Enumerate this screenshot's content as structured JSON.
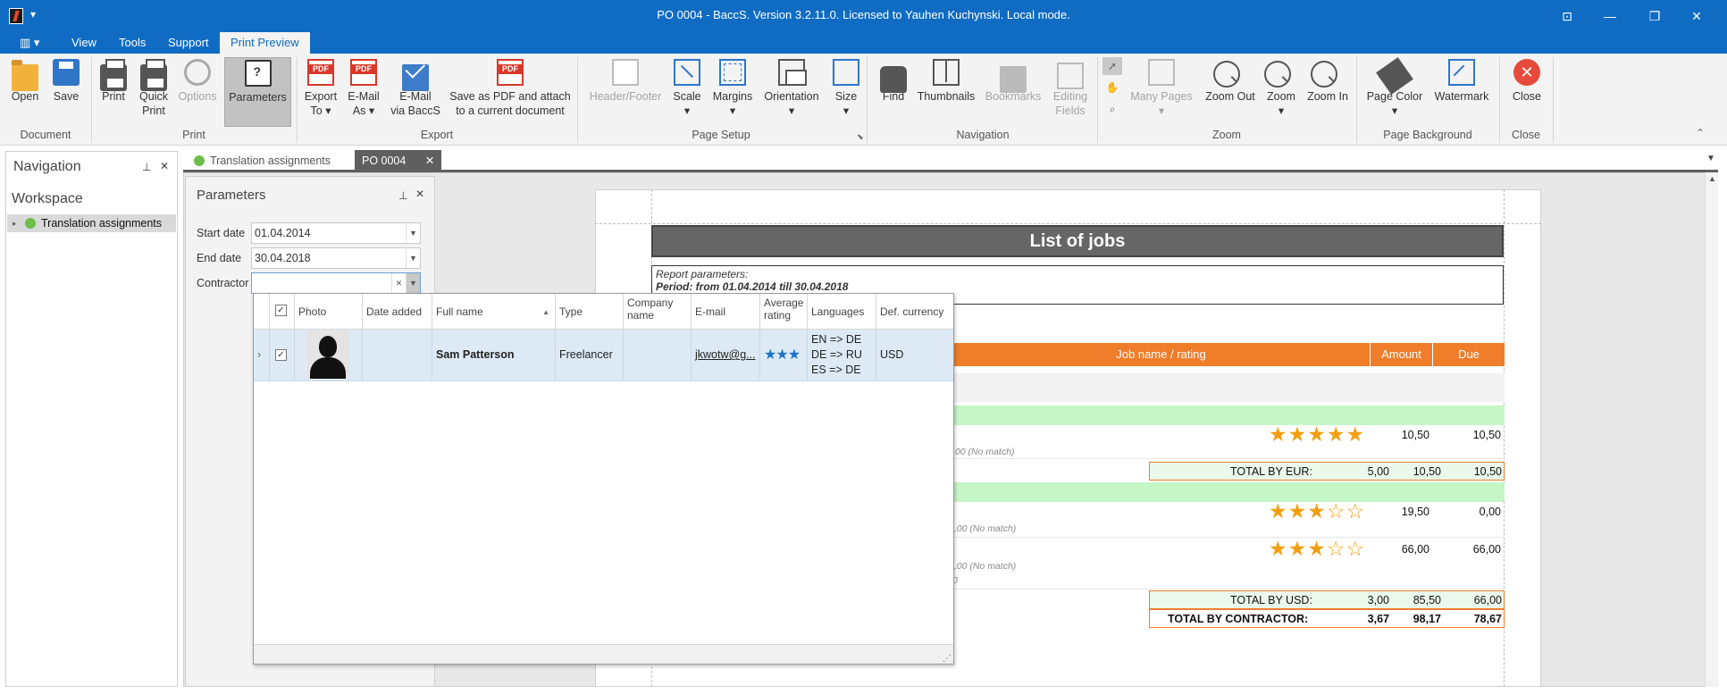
{
  "window": {
    "title": "PO 0004 - BaccS. Version 3.2.11.0. Licensed to Yauhen Kuchynski. Local mode.",
    "quick_access_glyph": "▾",
    "controls": [
      "⊡",
      "—",
      "❐",
      "✕"
    ]
  },
  "menu": {
    "app_menu": "▥ ▾",
    "items": [
      "View",
      "Tools",
      "Support",
      "Print Preview"
    ]
  },
  "ribbon": {
    "document": {
      "open": "Open",
      "save": "Save",
      "group": "Document"
    },
    "print": {
      "print": "Print",
      "quick_print_1": "Quick",
      "quick_print_2": "Print",
      "options": "Options",
      "parameters": "Parameters",
      "group": "Print"
    },
    "export": {
      "export_to_1": "Export",
      "export_to_2": "To ▾",
      "email_as_1": "E-Mail",
      "email_as_2": "As ▾",
      "email_baccs_1": "E-Mail",
      "email_baccs_2": "via BaccS",
      "save_pdf_1": "Save as PDF and attach",
      "save_pdf_2": "to a current document",
      "group": "Export"
    },
    "page_setup": {
      "header_footer": "Header/Footer",
      "scale": "Scale",
      "margins": "Margins",
      "orientation": "Orientation",
      "size": "Size",
      "dropdown": "▾",
      "group": "Page Setup"
    },
    "navigation": {
      "find": "Find",
      "thumbnails": "Thumbnails",
      "bookmarks": "Bookmarks",
      "editing_fields_1": "Editing",
      "editing_fields_2": "Fields",
      "group": "Navigation"
    },
    "zoom": {
      "many_pages": "Many Pages",
      "zoom_out": "Zoom Out",
      "zoom": "Zoom",
      "zoom_in": "Zoom In",
      "group": "Zoom"
    },
    "page_background": {
      "page_color": "Page Color",
      "watermark": "Watermark",
      "group": "Page Background"
    },
    "close": {
      "close": "Close",
      "group": "Close"
    }
  },
  "nav_pane": {
    "title": "Navigation",
    "workspace": "Workspace",
    "items": [
      "Translation assignments"
    ]
  },
  "doc_tabs": [
    "Translation assignments",
    "PO 0004"
  ],
  "parameters": {
    "title": "Parameters",
    "start_date_label": "Start date",
    "start_date": "01.04.2014",
    "end_date_label": "End date",
    "end_date": "30.04.2018",
    "contractor_label": "Contractor",
    "contractor": ""
  },
  "contractor_grid": {
    "columns": [
      "Photo",
      "Date added",
      "Full name",
      "Type",
      "Company name",
      "E-mail",
      "Average rating",
      "Languages",
      "Def. currency"
    ],
    "sort_indicator": "▲",
    "row": {
      "expander": "›",
      "checked": "✓",
      "date_added": "",
      "full_name": "Sam Patterson",
      "type": "Freelancer",
      "company": "",
      "email": "jkwotw@g...",
      "rating_stars": "★★★",
      "rating": 3,
      "languages": [
        "EN => DE",
        "DE => RU",
        "ES => DE"
      ],
      "currency": "USD"
    }
  },
  "report": {
    "title": "List of jobs",
    "params_label": "Report parameters:",
    "period": "Period: from 01.04.2014 till 30.04.2018",
    "columns": {
      "job": "Job name / rating",
      "amount": "Amount",
      "due": "Due"
    },
    "rows": [
      {
        "stars": "★★★★★",
        "rating": 5,
        "amount": "10,50",
        "due": "10,50",
        "note": ",00  (No match)"
      },
      {
        "stars": "★★★☆☆",
        "rating": 3,
        "amount": "19,50",
        "due": "0,00",
        "note": "0,00  (No match)"
      },
      {
        "stars": "★★★☆☆",
        "rating": 3,
        "amount": "66,00",
        "due": "66,00",
        "note": "0,00  (No match)",
        "note2": "0"
      }
    ],
    "total_eur": {
      "label": "TOTAL BY EUR:",
      "rating": "5,00",
      "amount": "10,50",
      "due": "10,50"
    },
    "total_usd": {
      "label": "TOTAL BY USD:",
      "rating": "3,00",
      "amount": "85,50",
      "due": "66,00"
    },
    "total_contractor": {
      "label": "TOTAL BY CONTRACTOR:",
      "rating": "3,67",
      "amount": "98,17",
      "due": "78,67"
    }
  },
  "colors": {
    "accent": "#0f6cc2",
    "report_header": "#ef7d2a",
    "star": "#f29f0f",
    "rating_star": "#1e73c8"
  }
}
